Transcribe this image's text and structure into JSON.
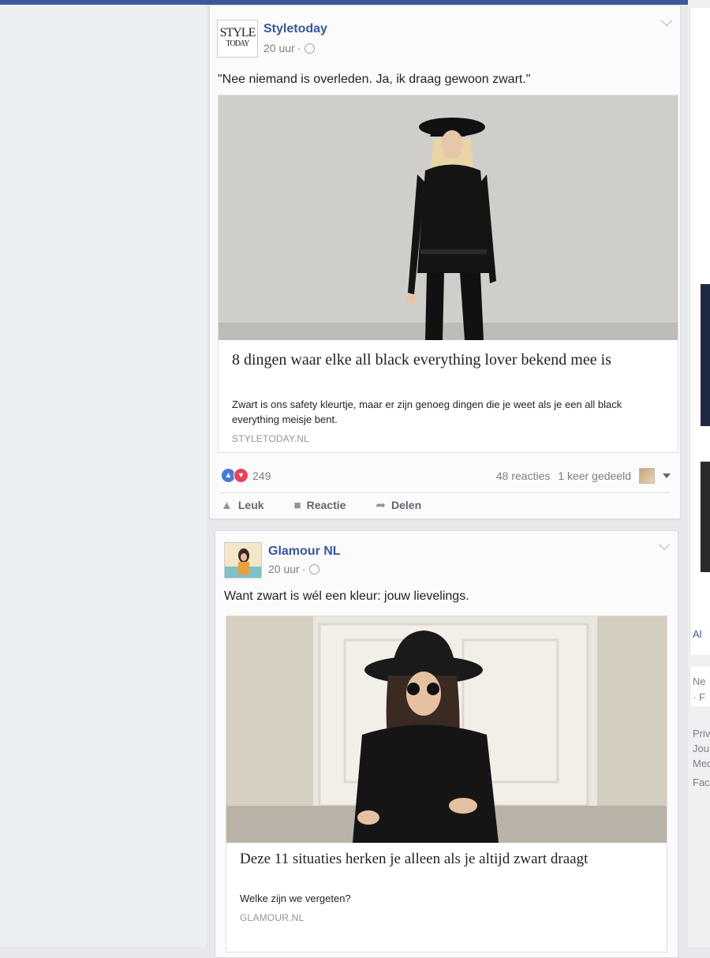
{
  "posts": [
    {
      "page_name": "Styletoday",
      "avatar_line1": "STYLE",
      "avatar_line2": "TODAY",
      "time": "20 uur",
      "separator": "·",
      "text": "\"Nee niemand is overleden. Ja, ik draag gewoon zwart.\"",
      "link": {
        "title": "8 dingen waar elke all black everything lover bekend mee is",
        "description": "Zwart is ons safety kleurtje, maar er zijn genoeg dingen die je weet als je een all black everything meisje bent.",
        "domain": "STYLETODAY.NL"
      },
      "reactions_count": "249",
      "comments": "48 reacties",
      "shares": "1 keer gedeeld",
      "actions": {
        "like": "Leuk",
        "comment": "Reactie",
        "share": "Delen"
      }
    },
    {
      "page_name": "Glamour NL",
      "time": "20 uur",
      "separator": "·",
      "text": "Want zwart is wél een kleur: jouw lievelings.",
      "link": {
        "title": "Deze 11 situaties herken je alleen als je altijd zwart draagt",
        "description": "Welke zijn we vergeten?",
        "domain": "GLAMOUR.NL"
      }
    }
  ],
  "right_column": {
    "text_al": "Al",
    "text_ne": "Ne",
    "text_f": "· F",
    "footer": [
      "Priv",
      "Jou",
      "Med",
      "Fac"
    ]
  },
  "colors": {
    "link_blue": "#365899",
    "topbar": "#3b5998",
    "like_blue": "#4a78d6",
    "love_red": "#e8405a"
  }
}
